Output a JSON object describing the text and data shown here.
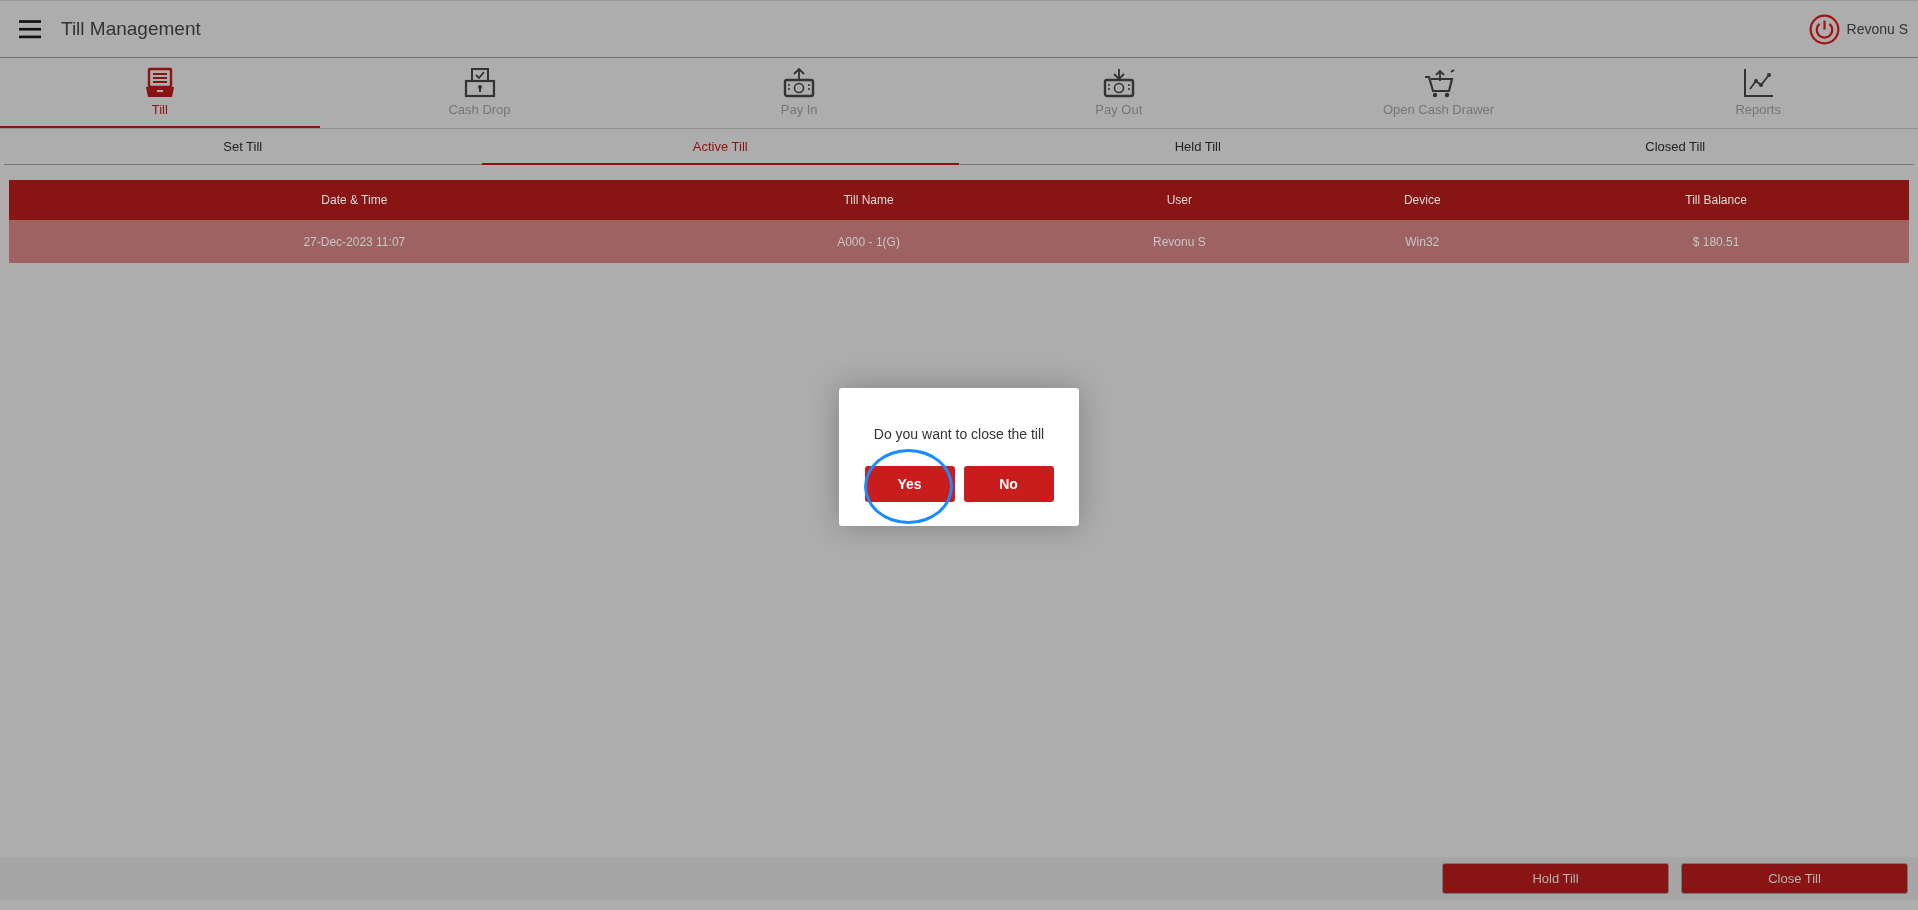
{
  "header": {
    "title": "Till Management",
    "user": "Revonu S"
  },
  "tabs": [
    {
      "label": "Till",
      "kind": "till",
      "selected": true
    },
    {
      "label": "Cash Drop",
      "kind": "cashdrop",
      "selected": false
    },
    {
      "label": "Pay In",
      "kind": "payin",
      "selected": false
    },
    {
      "label": "Pay Out",
      "kind": "payout",
      "selected": false
    },
    {
      "label": "Open Cash Drawer",
      "kind": "cart",
      "selected": false
    },
    {
      "label": "Reports",
      "kind": "chart",
      "selected": false
    }
  ],
  "sub_tabs": [
    {
      "label": "Set Till",
      "selected": false
    },
    {
      "label": "Active Till",
      "selected": true
    },
    {
      "label": "Held Till",
      "selected": false
    },
    {
      "label": "Closed Till",
      "selected": false
    }
  ],
  "table": {
    "columns": [
      "Date & Time",
      "Till Name",
      "User",
      "Device",
      "Till Balance"
    ],
    "rows": [
      {
        "cells": [
          "27-Dec-2023 11:07",
          "A000 - 1(G)",
          "Revonu S",
          "Win32",
          "$ 180.51"
        ],
        "selected": true
      }
    ]
  },
  "dialog": {
    "message": "Do you want to close the till",
    "buttons": [
      {
        "label": "Yes",
        "highlighted": true
      },
      {
        "label": "No",
        "highlighted": false
      }
    ]
  },
  "footer": {
    "buttons": [
      "Hold Till",
      "Close Till"
    ]
  }
}
